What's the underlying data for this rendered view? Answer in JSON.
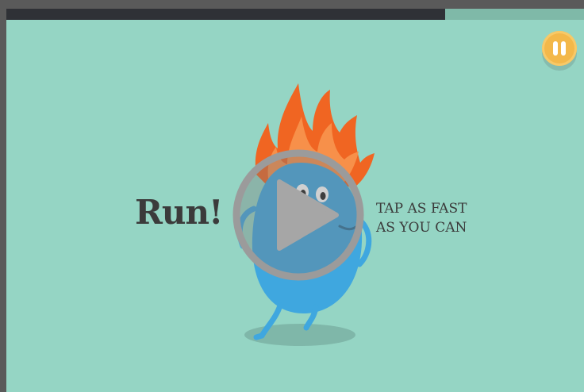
{
  "video": {
    "progress_fraction": 0.76
  },
  "game": {
    "instruction_title": "Run!",
    "instruction_line1": "TAP AS FAST",
    "instruction_line2": "AS YOU CAN"
  },
  "controls": {
    "pause_icon": "pause-icon",
    "play_icon": "play-icon"
  },
  "colors": {
    "background": "#95d5c4",
    "character_body": "#3fa7df",
    "flames": "#f06522",
    "pause_button": "#f3b84a",
    "progress_fill": "#2f3136",
    "text": "#3b3b3b"
  }
}
